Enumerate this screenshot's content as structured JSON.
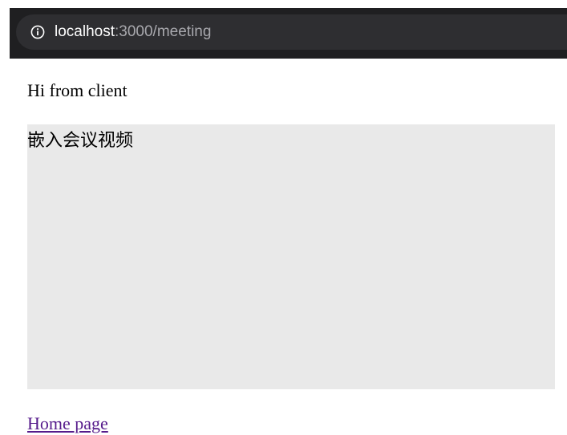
{
  "browser": {
    "url_host": "localhost",
    "url_rest": ":3000/meeting",
    "info_icon": "info-circle-icon"
  },
  "page": {
    "greeting": "Hi from client",
    "video_caption": "嵌入会议视频",
    "home_link": "Home page"
  },
  "colors": {
    "toolbar": "#1f1f21",
    "url_bar": "#2e2e31",
    "video_bg": "#e9e9e9",
    "visited_link": "#551a8b"
  }
}
